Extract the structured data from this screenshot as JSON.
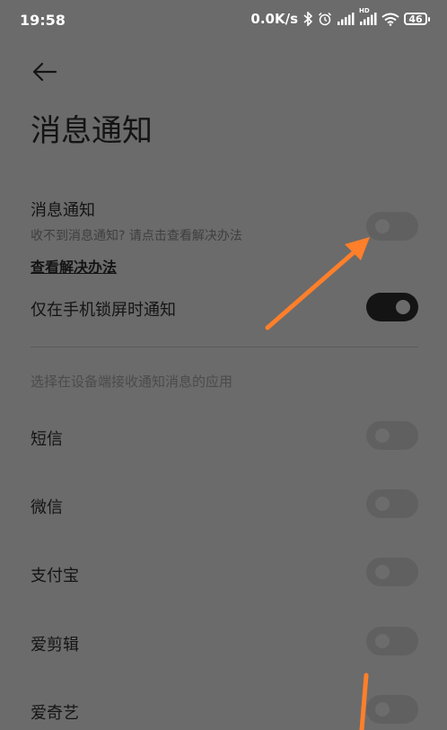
{
  "status_bar": {
    "time": "19:58",
    "net_speed": "0.0K/s",
    "battery": "46",
    "hd_label": "HD"
  },
  "header": {
    "back_icon": "arrow-left-icon",
    "title": "消息通知"
  },
  "settings": {
    "notification": {
      "title": "消息通知",
      "subtitle": "收不到消息通知? 请点击查看解决办法",
      "enabled": false
    },
    "solution_link": "查看解决办法",
    "lockscreen_only": {
      "title": "仅在手机锁屏时通知",
      "enabled": true
    }
  },
  "apps_section": {
    "label": "选择在设备端接收通知消息的应用",
    "apps": [
      {
        "name": "短信",
        "enabled": false
      },
      {
        "name": "微信",
        "enabled": false
      },
      {
        "name": "支付宝",
        "enabled": false
      },
      {
        "name": "爱剪辑",
        "enabled": false
      },
      {
        "name": "爱奇艺",
        "enabled": false
      }
    ]
  },
  "colors": {
    "overlay_bg": "#6b6b6b",
    "annotation_arrow": "#ff7f2a",
    "toggle_on": "#141414",
    "toggle_off": "#606060"
  }
}
